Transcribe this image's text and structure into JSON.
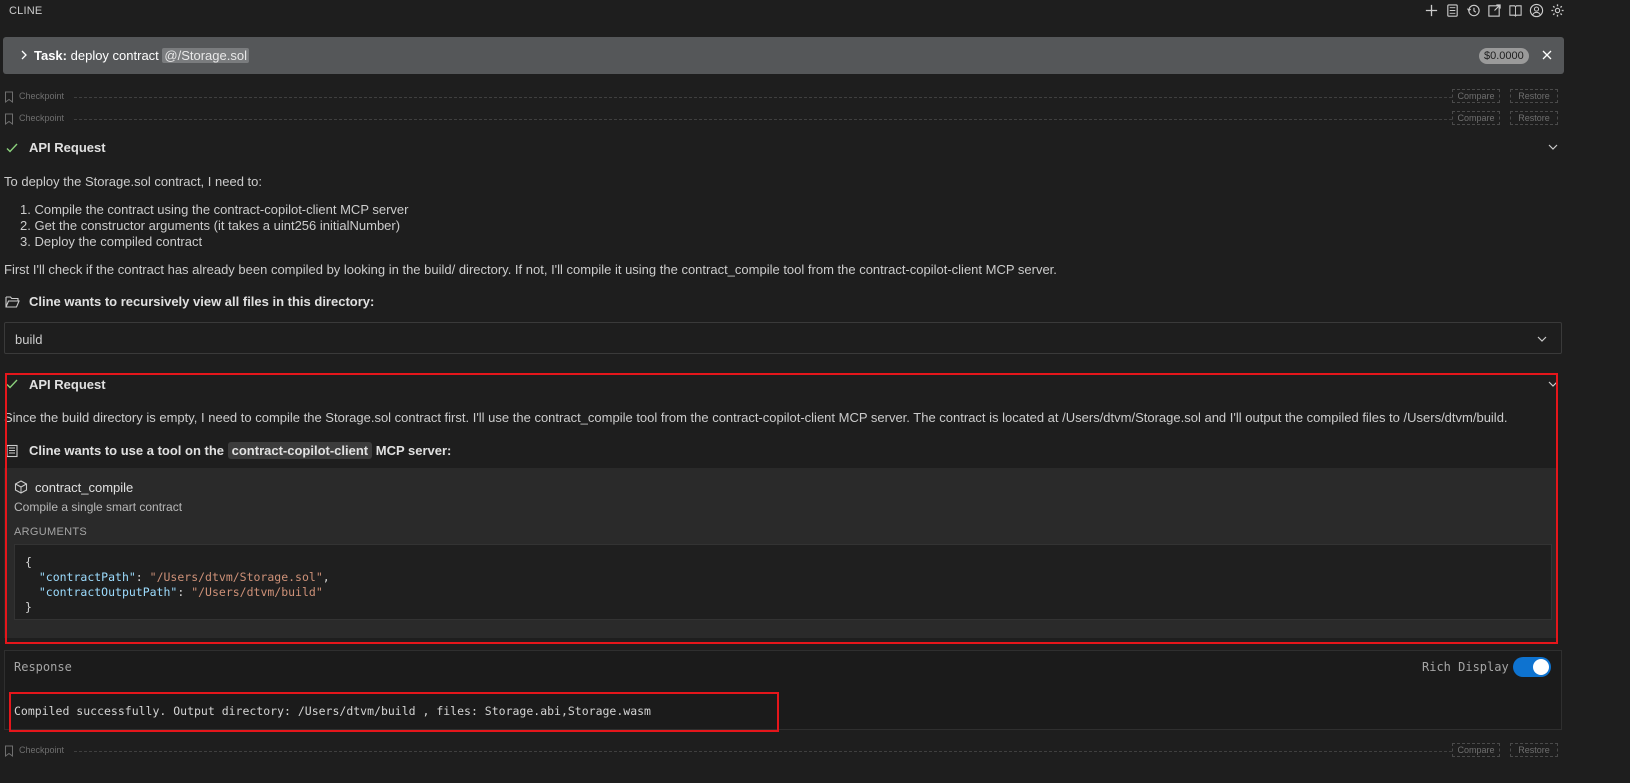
{
  "app": {
    "title": "CLINE"
  },
  "toolbar_icons": [
    "plus-icon",
    "mcp-server-icon",
    "history-icon",
    "popout-icon",
    "book-icon",
    "account-icon",
    "gear-icon"
  ],
  "task": {
    "label": "Task:",
    "text": "deploy contract ",
    "mention": "@/Storage.sol",
    "cost": "$0.0000"
  },
  "checkpoints": [
    {
      "label": "Checkpoint",
      "compare": "Compare",
      "restore": "Restore"
    },
    {
      "label": "Checkpoint",
      "compare": "Compare",
      "restore": "Restore"
    },
    {
      "label": "Checkpoint",
      "compare": "Compare",
      "restore": "Restore"
    }
  ],
  "messages": {
    "api_request_1": {
      "title": "API Request",
      "intro": "To deploy the Storage.sol contract, I need to:",
      "steps": [
        "1. Compile the contract using the contract-copilot-client MCP server",
        "2. Get the constructor arguments (it takes a uint256 initialNumber)",
        "3. Deploy the compiled contract"
      ],
      "followup": "First I'll check if the contract has already been compiled by looking in the build/ directory. If not, I'll compile it using the contract_compile tool from the contract-copilot-client MCP server."
    },
    "view_files": {
      "title": "Cline wants to recursively view all files in this directory:",
      "directory": "build"
    },
    "api_request_2": {
      "title": "API Request",
      "text": "Since the build directory is empty, I need to compile the Storage.sol contract first. I'll use the contract_compile tool from the contract-copilot-client MCP server. The contract is located at /Users/dtvm/Storage.sol and I'll output the compiled files to /Users/dtvm/build."
    },
    "mcp_tool": {
      "title_prefix": "Cline wants to use a tool on the ",
      "server": "contract-copilot-client",
      "title_suffix": " MCP server:",
      "tool_name": "contract_compile",
      "tool_desc": "Compile a single smart contract",
      "args_label": "ARGUMENTS",
      "args": {
        "open": "{",
        "k1": "\"contractPath\"",
        "v1": "\"/Users/dtvm/Storage.sol\"",
        "k2": "\"contractOutputPath\"",
        "v2": "\"/Users/dtvm/build\"",
        "close": "}"
      }
    },
    "response": {
      "label": "Response",
      "rich_display_label": "Rich Display",
      "rich_display_on": true,
      "text": "Compiled successfully. Output directory: /Users/dtvm/build , files: Storage.abi,Storage.wasm"
    }
  },
  "colors": {
    "background": "#1e1e1e",
    "task_bar": "#555759",
    "highlight_border": "#e5161b",
    "toggle_on": "#0e73d0"
  }
}
